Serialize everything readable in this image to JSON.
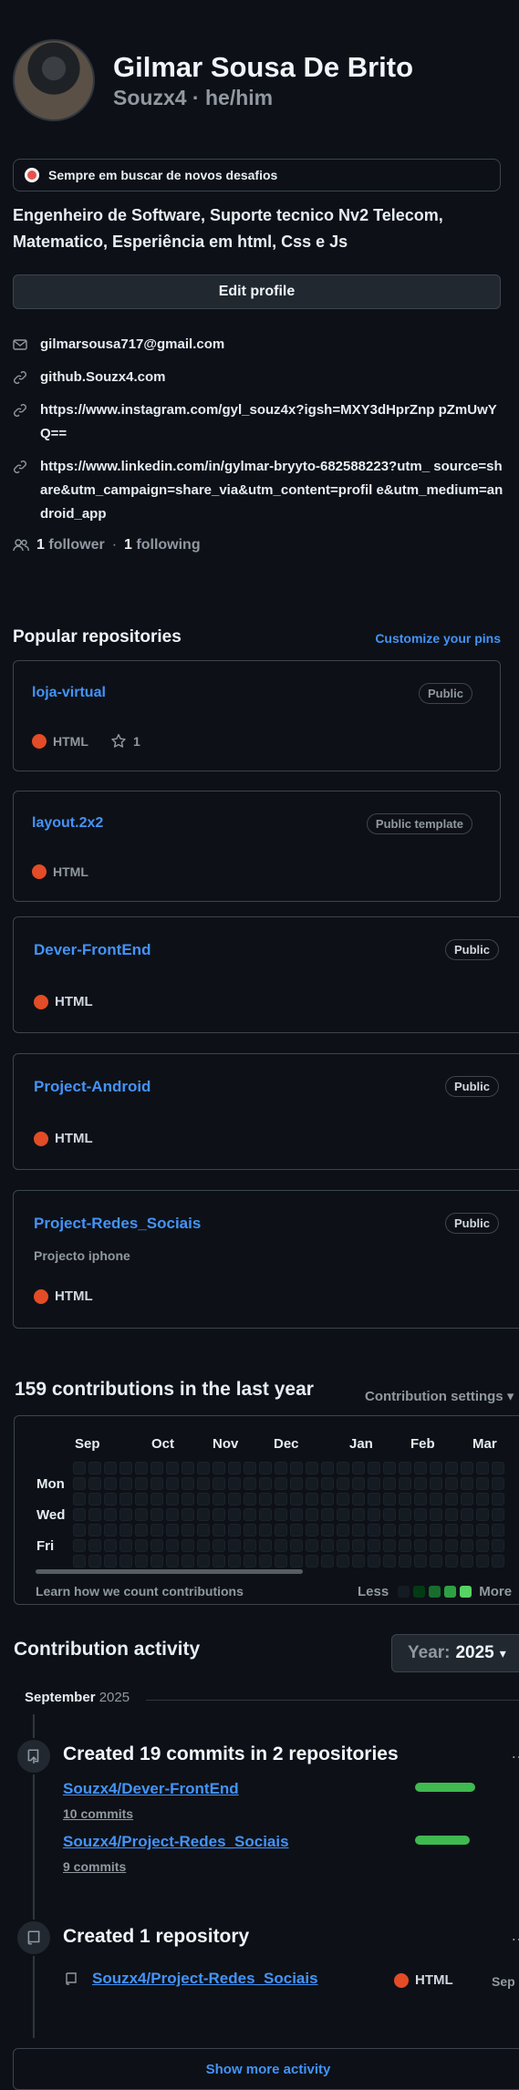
{
  "profile": {
    "name": "Gilmar Sousa De Brito",
    "login": "Souzx4",
    "pronouns": "he/him",
    "separator": "·",
    "status": "Sempre em buscar de novos desafios",
    "bio": "Engenheiro de Software, Suporte tecnico Nv2 Telecom, Matematico, Esperiência em html, Css e Js",
    "edit_button": "Edit profile",
    "email": "gilmarsousa717@gmail.com",
    "links": [
      "github.Souzx4.com",
      "https://www.instagram.com/gyl_souz4x?igsh=MXY3dHprZnp pZmUwYQ==",
      "https://www.linkedin.com/in/gylmar-bryyto-682588223?utm_ source=share&utm_campaign=share_via&utm_content=profil e&utm_medium=android_app"
    ],
    "followers_count": "1",
    "followers_label": "follower",
    "following_count": "1",
    "following_label": "following"
  },
  "pinned": {
    "title": "Popular repositories",
    "customize_link": "Customize your pins",
    "repos": [
      {
        "name": "loja-virtual",
        "visibility": "Public",
        "language": "HTML",
        "stars": "1"
      },
      {
        "name": "layout.2x2",
        "visibility": "Public template",
        "language": "HTML"
      },
      {
        "name": "Dever-FrontEnd",
        "visibility": "Public",
        "language": "HTML"
      },
      {
        "name": "Project-Android",
        "visibility": "Public",
        "language": "HTML"
      },
      {
        "name": "Project-Redes_Sociais",
        "visibility": "Public",
        "language": "HTML",
        "description": "Projecto iphone"
      }
    ]
  },
  "contributions": {
    "title": "159 contributions in the last year",
    "settings": "Contribution settings",
    "months": [
      "Sep",
      "Oct",
      "Nov",
      "Dec",
      "Jan",
      "Feb",
      "Mar"
    ],
    "day_labels": [
      "Mon",
      "Wed",
      "Fri"
    ],
    "learn_link": "Learn how we count contributions",
    "legend_less": "Less",
    "legend_more": "More",
    "legend_colors": [
      "#151b23",
      "#033a16",
      "#196c2e",
      "#2ea043",
      "#56d364"
    ]
  },
  "activity": {
    "title": "Contribution activity",
    "year_label": "Year:",
    "year_value": "2025",
    "month": "September",
    "month_year": "2025",
    "commits_event": {
      "title": "Created 19 commits in 2 repositories",
      "repos": [
        {
          "name": "Souzx4/Dever-FrontEnd",
          "commits": "10 commits",
          "share": 0.55
        },
        {
          "name": "Souzx4/Project-Redes_Sociais",
          "commits": "9 commits",
          "share": 0.5
        }
      ]
    },
    "repo_event": {
      "title": "Created 1 repository",
      "repo": "Souzx4/Project-Redes_Sociais",
      "language": "HTML",
      "date": "Sep"
    },
    "show_more": "Show more activity"
  },
  "colors": {
    "accent": "#4493f8",
    "html": "#e34c26",
    "green": "#3fb950"
  }
}
